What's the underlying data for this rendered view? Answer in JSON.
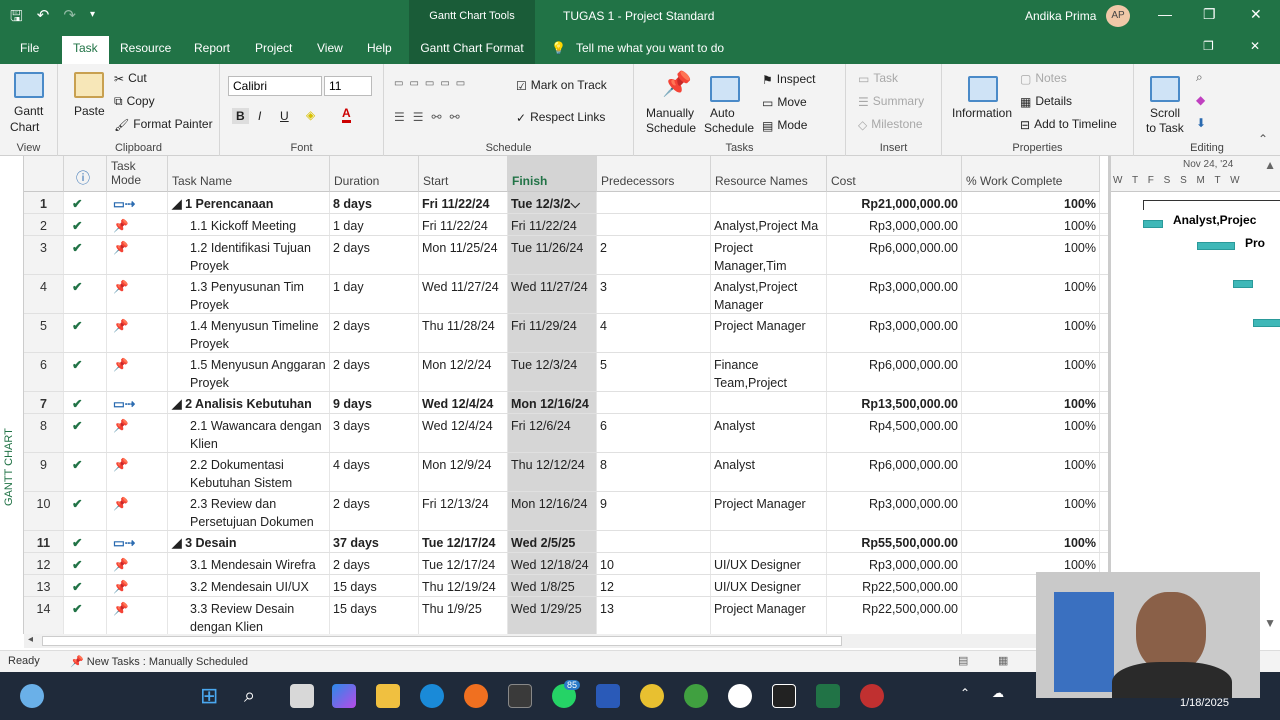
{
  "titlebar": {
    "context_tab": "Gantt Chart Tools",
    "title": "TUGAS 1  -  Project Standard",
    "user": "Andika Prima",
    "avatar": "AP"
  },
  "menu": {
    "file": "File",
    "task": "Task",
    "resource": "Resource",
    "report": "Report",
    "project": "Project",
    "view": "View",
    "help": "Help",
    "ctx": "Gantt Chart Format",
    "tell": "Tell me what you want to do"
  },
  "ribbon": {
    "view": {
      "gantt": "Gantt",
      "chart": "Chart",
      "label": "View"
    },
    "clipboard": {
      "paste": "Paste",
      "cut": "Cut",
      "copy": "Copy",
      "painter": "Format Painter",
      "label": "Clipboard"
    },
    "font": {
      "name": "Calibri",
      "size": "11",
      "bold": "B",
      "italic": "I",
      "underline": "U",
      "label": "Font"
    },
    "schedule": {
      "mark": "Mark on Track",
      "respect": "Respect Links",
      "label": "Schedule"
    },
    "tasks": {
      "manually": "Manually",
      "schedule1": "Schedule",
      "auto": "Auto",
      "schedule2": "Schedule",
      "inspect": "Inspect",
      "move": "Move",
      "mode": "Mode",
      "label": "Tasks"
    },
    "insert": {
      "task": "Task",
      "summary": "Summary",
      "milestone": "Milestone",
      "label": "Insert"
    },
    "properties": {
      "information": "Information",
      "notes": "Notes",
      "details": "Details",
      "timeline": "Add to Timeline",
      "label": "Properties"
    },
    "editing": {
      "scroll": "Scroll",
      "to_task": "to Task",
      "label": "Editing"
    }
  },
  "columns": {
    "mode": "Task Mode",
    "name": "Task Name",
    "duration": "Duration",
    "start": "Start",
    "finish": "Finish",
    "pred": "Predecessors",
    "resources": "Resource Names",
    "cost": "Cost",
    "work": "% Work Complete"
  },
  "side_label": "GANTT CHART",
  "tasks": [
    {
      "id": "1",
      "name": "◢ 1 Perencanaan",
      "duration": "8 days",
      "start": "Fri 11/22/24",
      "finish": "Tue 12/3/2⌵",
      "pred": "",
      "res": "",
      "cost": "Rp21,000,000.00",
      "work": "100%",
      "summary": true
    },
    {
      "id": "2",
      "name": "1.1 Kickoff Meeting",
      "duration": "1 day",
      "start": "Fri 11/22/24",
      "finish": "Fri 11/22/24",
      "pred": "",
      "res": "Analyst,Project Ma",
      "cost": "Rp3,000,000.00",
      "work": "100%"
    },
    {
      "id": "3",
      "name": "1.2 Identifikasi Tujuan Proyek",
      "duration": "2 days",
      "start": "Mon 11/25/24",
      "finish": "Tue 11/26/24",
      "pred": "2",
      "res": "Project Manager,Tim",
      "cost": "Rp6,000,000.00",
      "work": "100%"
    },
    {
      "id": "4",
      "name": "1.3 Penyusunan Tim Proyek",
      "duration": "1 day",
      "start": "Wed 11/27/24",
      "finish": "Wed 11/27/24",
      "pred": "3",
      "res": "Analyst,Project Manager",
      "cost": "Rp3,000,000.00",
      "work": "100%"
    },
    {
      "id": "5",
      "name": "1.4 Menyusun Timeline Proyek",
      "duration": "2 days",
      "start": "Thu 11/28/24",
      "finish": "Fri 11/29/24",
      "pred": "4",
      "res": "Project Manager",
      "cost": "Rp3,000,000.00",
      "work": "100%"
    },
    {
      "id": "6",
      "name": "1.5 Menyusun Anggaran Proyek",
      "duration": "2 days",
      "start": "Mon 12/2/24",
      "finish": "Tue 12/3/24",
      "pred": "5",
      "res": "Finance Team,Project",
      "cost": "Rp6,000,000.00",
      "work": "100%"
    },
    {
      "id": "7",
      "name": "◢ 2 Analisis Kebutuhan",
      "duration": "9 days",
      "start": "Wed 12/4/24",
      "finish": "Mon 12/16/24",
      "pred": "",
      "res": "",
      "cost": "Rp13,500,000.00",
      "work": "100%",
      "summary": true
    },
    {
      "id": "8",
      "name": "2.1 Wawancara dengan Klien",
      "duration": "3 days",
      "start": "Wed 12/4/24",
      "finish": "Fri 12/6/24",
      "pred": "6",
      "res": "Analyst",
      "cost": "Rp4,500,000.00",
      "work": "100%"
    },
    {
      "id": "9",
      "name": "2.2 Dokumentasi Kebutuhan Sistem",
      "duration": "4 days",
      "start": "Mon 12/9/24",
      "finish": "Thu 12/12/24",
      "pred": "8",
      "res": "Analyst",
      "cost": "Rp6,000,000.00",
      "work": "100%"
    },
    {
      "id": "10",
      "name": "2.3 Review dan Persetujuan Dokumen",
      "duration": "2 days",
      "start": "Fri 12/13/24",
      "finish": "Mon 12/16/24",
      "pred": "9",
      "res": "Project Manager",
      "cost": "Rp3,000,000.00",
      "work": "100%"
    },
    {
      "id": "11",
      "name": "◢ 3 Desain",
      "duration": "37 days",
      "start": "Tue 12/17/24",
      "finish": "Wed 2/5/25",
      "pred": "",
      "res": "",
      "cost": "Rp55,500,000.00",
      "work": "100%",
      "summary": true
    },
    {
      "id": "12",
      "name": "3.1 Mendesain Wirefra",
      "duration": "2 days",
      "start": "Tue 12/17/24",
      "finish": "Wed 12/18/24",
      "pred": "10",
      "res": "UI/UX Designer",
      "cost": "Rp3,000,000.00",
      "work": "100%"
    },
    {
      "id": "13",
      "name": "3.2 Mendesain UI/UX",
      "duration": "15 days",
      "start": "Thu 12/19/24",
      "finish": "Wed 1/8/25",
      "pred": "12",
      "res": "UI/UX Designer",
      "cost": "Rp22,500,000.00",
      "work": ""
    },
    {
      "id": "14",
      "name": "3.3  Review Desain dengan Klien",
      "duration": "15 days",
      "start": "Thu 1/9/25",
      "finish": "Wed 1/29/25",
      "pred": "13",
      "res": "Project Manager",
      "cost": "Rp22,500,000.00",
      "work": ""
    }
  ],
  "gantt": {
    "week": "Nov 24, '24",
    "days": "W T F S S M T W",
    "label1": "Analyst,Projec",
    "label2": "Pro"
  },
  "status": {
    "ready": "Ready",
    "mode": "New Tasks : Manually Scheduled"
  },
  "taskbar": {
    "date": "1/18/2025",
    "lang": "ENG",
    "badge": "85"
  }
}
